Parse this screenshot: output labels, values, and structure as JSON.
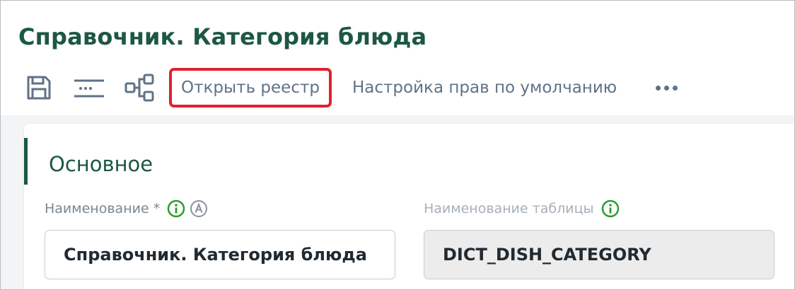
{
  "page": {
    "title": "Справочник. Категория блюда"
  },
  "toolbar": {
    "icons": {
      "save": "save-icon",
      "fields": "fields-list-icon",
      "relations": "relations-diagram-icon",
      "more": "more-horizontal-icon"
    },
    "open_registry_label": "Открыть реестр",
    "default_rights_label": "Настройка прав по умолчанию"
  },
  "section": {
    "title": "Основное",
    "fields": [
      {
        "label": "Наименование *",
        "value": "Справочник. Категория блюда",
        "icons": [
          "info-icon",
          "auto-icon"
        ]
      },
      {
        "label": "Наименование таблицы",
        "value": "DICT_DISH_CATEGORY",
        "icons": [
          "info-icon"
        ]
      }
    ]
  },
  "colors": {
    "brand": "#1d5745",
    "highlight": "#e0202e",
    "info_icon": "#2a9d2a",
    "muted_text": "#5f7287"
  }
}
